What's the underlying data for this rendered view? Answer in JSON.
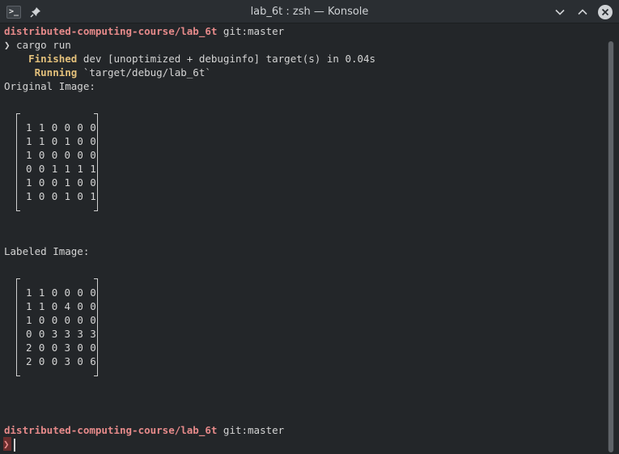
{
  "window": {
    "title": "lab_6t : zsh — Konsole",
    "app_icon": ">_"
  },
  "colors": {
    "background": "#232629",
    "directory": "#e68a8a",
    "cargo_status": "#e3c07b",
    "text": "#d4d4d4"
  },
  "terminal": {
    "prompt1": {
      "dir": "distributed-computing-course/lab_6t",
      "git": " git:master"
    },
    "command": {
      "marker": "❯",
      "text": " cargo run"
    },
    "finished": {
      "label": "    Finished",
      "text": " dev [unoptimized + debuginfo] target(s) in 0.04s"
    },
    "running": {
      "label": "     Running",
      "text": " `target/debug/lab_6t`"
    },
    "original_label": "Original Image:",
    "original_rows": [
      "1 1 0 0 0 0",
      "1 1 0 1 0 0",
      "1 0 0 0 0 0",
      "0 0 1 1 1 1",
      "1 0 0 1 0 0",
      "1 0 0 1 0 1"
    ],
    "labeled_label": "Labeled Image:",
    "labeled_rows": [
      "1 1 0 0 0 0",
      "1 1 0 4 0 0",
      "1 0 0 0 0 0",
      "0 0 3 3 3 3",
      "2 0 0 3 0 0",
      "2 0 0 3 0 6"
    ],
    "prompt2": {
      "dir": "distributed-computing-course/lab_6t",
      "git": " git:master"
    },
    "prompt2_marker": "❯"
  }
}
